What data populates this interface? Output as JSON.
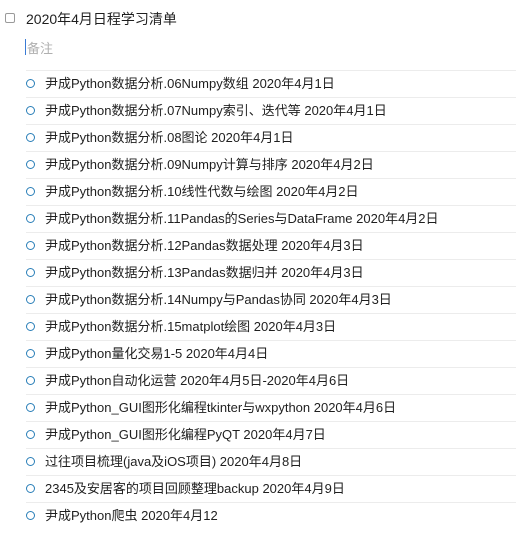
{
  "task": {
    "title": "2020年4月日程学习清单",
    "notes_placeholder": "备注"
  },
  "subtasks": [
    {
      "label": "尹成Python数据分析.06Numpy数组 2020年4月1日"
    },
    {
      "label": "尹成Python数据分析.07Numpy索引、迭代等 2020年4月1日"
    },
    {
      "label": "尹成Python数据分析.08图论 2020年4月1日"
    },
    {
      "label": "尹成Python数据分析.09Numpy计算与排序 2020年4月2日"
    },
    {
      "label": "尹成Python数据分析.10线性代数与绘图 2020年4月2日"
    },
    {
      "label": "尹成Python数据分析.11Pandas的Series与DataFrame 2020年4月2日"
    },
    {
      "label": "尹成Python数据分析.12Pandas数据处理 2020年4月3日"
    },
    {
      "label": "尹成Python数据分析.13Pandas数据归并 2020年4月3日"
    },
    {
      "label": "尹成Python数据分析.14Numpy与Pandas协同  2020年4月3日"
    },
    {
      "label": "尹成Python数据分析.15matplot绘图  2020年4月3日"
    },
    {
      "label": "尹成Python量化交易1-5  2020年4月4日"
    },
    {
      "label": "尹成Python自动化运营 2020年4月5日-2020年4月6日"
    },
    {
      "label": "尹成Python_GUI图形化编程tkinter与wxpython  2020年4月6日"
    },
    {
      "label": "尹成Python_GUI图形化编程PyQT  2020年4月7日"
    },
    {
      "label": "过往项目梳理(java及iOS项目) 2020年4月8日"
    },
    {
      "label": "2345及安居客的项目回顾整理backup 2020年4月9日"
    },
    {
      "label": "尹成Python爬虫 2020年4月12"
    }
  ],
  "colors": {
    "accent": "#2a7fb8",
    "caret": "#3a7bd5",
    "placeholder": "#b0b0b0"
  }
}
